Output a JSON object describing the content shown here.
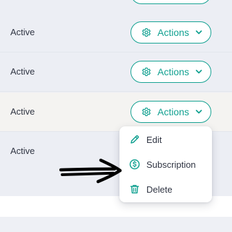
{
  "table": {
    "rows": [
      {
        "status": "Active",
        "actions_label": "Actions"
      },
      {
        "status": "Active",
        "actions_label": "Actions"
      },
      {
        "status": "Active",
        "actions_label": "Actions"
      },
      {
        "status": "Active"
      }
    ]
  },
  "menu": {
    "items": [
      {
        "label": "Edit",
        "icon": "pencil-icon"
      },
      {
        "label": "Subscription",
        "icon": "dollar-circle-icon"
      },
      {
        "label": "Delete",
        "icon": "trash-icon"
      }
    ]
  },
  "annotation": {
    "icon": "hand-drawn-arrow-icon",
    "color": "#000000"
  },
  "colors": {
    "accent": "#12a191",
    "text": "#2f3442",
    "row_background": "#eceef4",
    "row_hover_background": "#f4f3f1"
  }
}
